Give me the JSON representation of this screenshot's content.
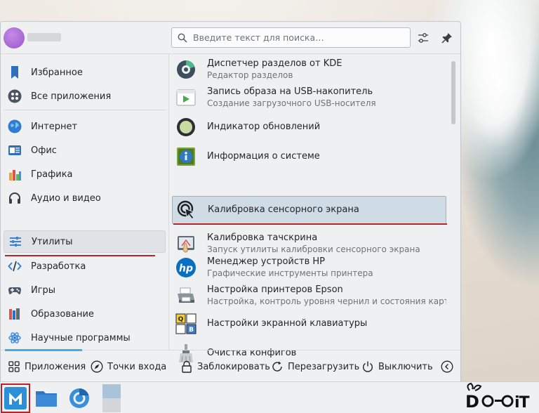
{
  "header": {
    "search_placeholder": "Введите текст для поиска…"
  },
  "categories": [
    {
      "label": "Избранное",
      "icon": "bookmark-icon"
    },
    {
      "label": "Все приложения",
      "icon": "grid-icon"
    },
    {
      "label": "Интернет",
      "icon": "globe-icon"
    },
    {
      "label": "Офис",
      "icon": "office-icon"
    },
    {
      "label": "Графика",
      "icon": "graphics-icon"
    },
    {
      "label": "Аудио и видео",
      "icon": "headphones-icon"
    },
    {
      "label": "Утилиты",
      "icon": "utilities-icon",
      "active": true
    },
    {
      "label": "Разработка",
      "icon": "code-icon"
    },
    {
      "label": "Игры",
      "icon": "gamepad-icon"
    },
    {
      "label": "Образование",
      "icon": "books-icon"
    },
    {
      "label": "Научные программы",
      "icon": "atom-icon"
    }
  ],
  "apps": [
    {
      "title": "Диспетчер разделов от KDE",
      "subtitle": "Редактор разделов",
      "icon": "partition-manager-icon"
    },
    {
      "title": "Запись образа на USB-накопитель",
      "subtitle": "Создание загрузочного USB-носителя",
      "icon": "usb-writer-icon"
    },
    {
      "title": "Индикатор обновлений",
      "subtitle": "",
      "icon": "update-indicator-icon"
    },
    {
      "title": "Информация о системе",
      "subtitle": "",
      "icon": "system-info-icon"
    },
    {
      "title": "Калибровка сенсорного экрана",
      "subtitle": "",
      "icon": "touch-calibration-icon",
      "selected": true
    },
    {
      "title": "Калибровка тачскрина",
      "subtitle": "Запуск утилиты калибровки сенсорного экрана",
      "icon": "touchscreen-calibrator-icon"
    },
    {
      "title": "Менеджер устройств HP",
      "subtitle": "Графические инструменты принтера",
      "icon": "hp-icon"
    },
    {
      "title": "Настройка принтеров Epson",
      "subtitle": "Настройка, контроль уровня чернил и состояния картри…",
      "icon": "printer-icon"
    },
    {
      "title": "Настройки экранной клавиатуры",
      "subtitle": "",
      "icon": "onscreen-keyboard-icon"
    },
    {
      "title": "Очистка конфигов",
      "subtitle": "",
      "icon": "config-cleaner-icon"
    }
  ],
  "footer": {
    "applications": "Приложения",
    "places": "Точки входа",
    "lock": "Заблокировать",
    "restart": "Перезагрузить",
    "shutdown": "Выключить"
  },
  "colors": {
    "accent": "#3daee9",
    "selection": "#cfdce6",
    "highlight_red": "#b5262a"
  }
}
